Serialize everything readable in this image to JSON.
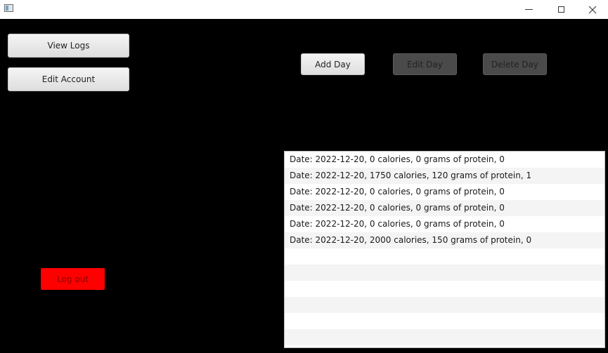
{
  "window": {
    "icon": "app-window-icon",
    "controls": [
      "minimize-icon",
      "maximize-icon",
      "close-icon"
    ]
  },
  "left_panel": {
    "view_logs_label": "View Logs",
    "edit_account_label": "Edit Account",
    "logout_label": "Log out"
  },
  "toolbar": {
    "add_day_label": "Add Day",
    "edit_day_label": "Edit Day",
    "delete_day_label": "Delete Day"
  },
  "log_list": {
    "items": [
      "Date: 2022-12-20, 0 calories, 0 grams of protein, 0",
      "Date: 2022-12-20, 1750 calories, 120 grams of protein, 1",
      "Date: 2022-12-20, 0 calories, 0 grams of protein, 0",
      "Date: 2022-12-20, 0 calories, 0 grams of protein, 0",
      "Date: 2022-12-20, 0 calories, 0 grams of protein, 0",
      "Date: 2022-12-20, 2000 calories, 150 grams of protein, 0",
      "",
      "",
      "",
      "",
      "",
      ""
    ]
  },
  "colors": {
    "background": "#000000",
    "logout": "#ff0000",
    "disabled_button": "#4a4a4a"
  }
}
